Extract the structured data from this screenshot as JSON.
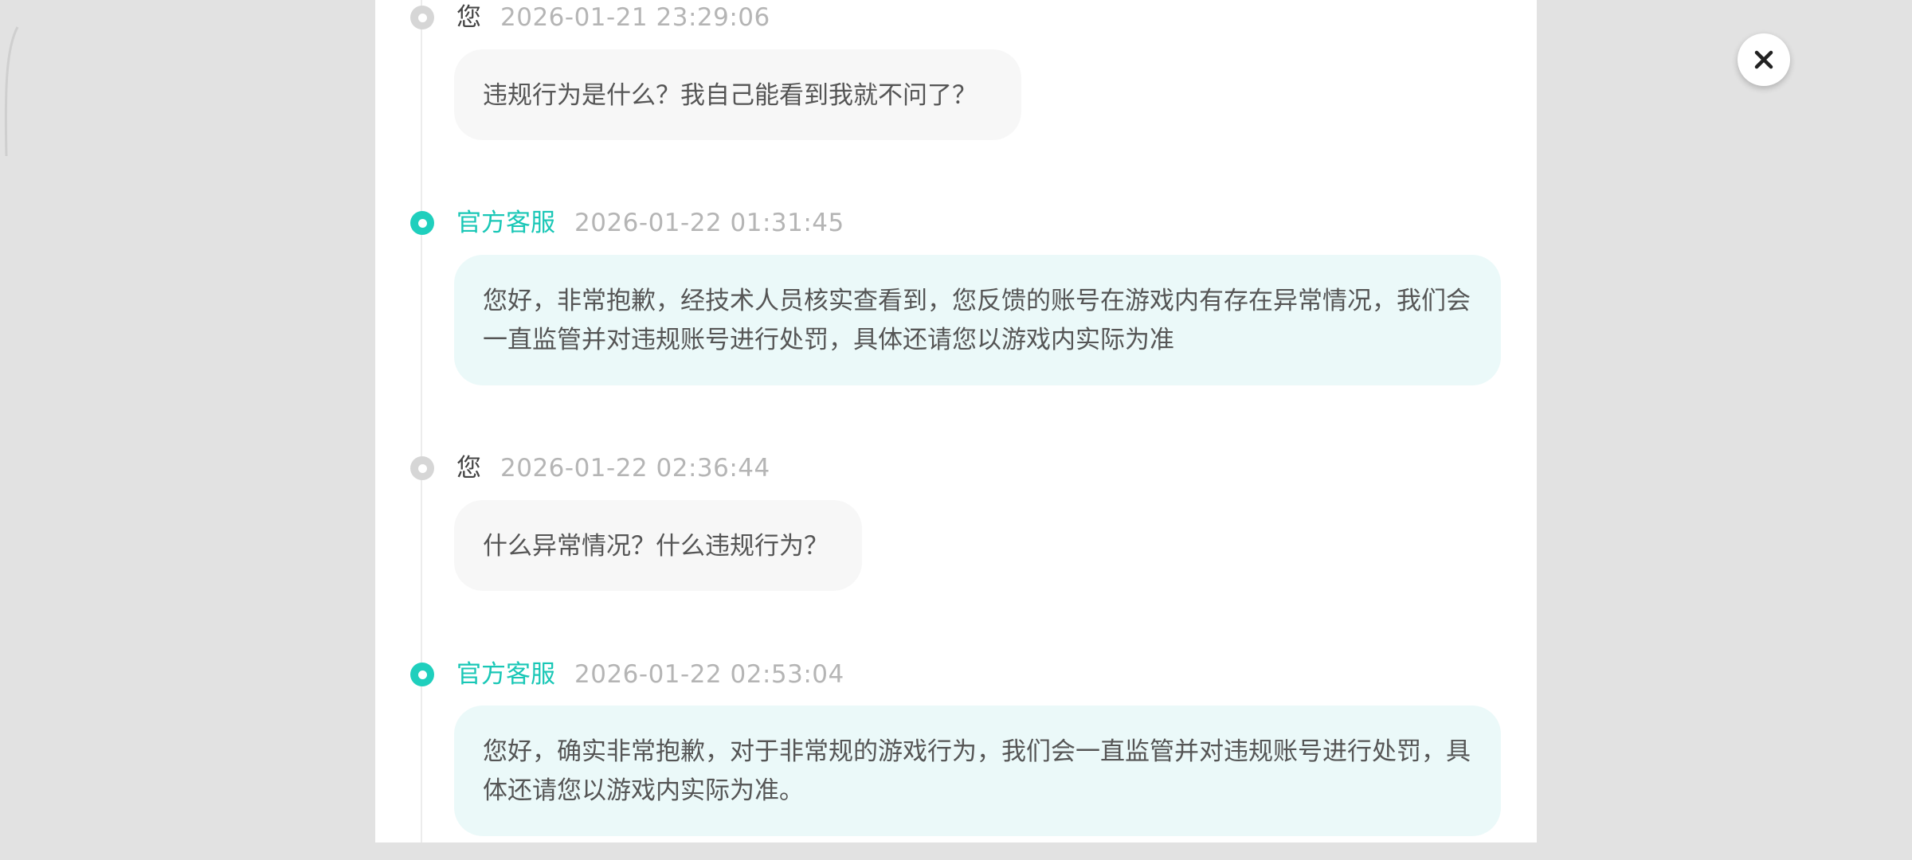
{
  "close_icon": "close-icon",
  "colors": {
    "accent": "#19c7b6",
    "agent_bubble": "#ebf9f9",
    "user_bubble": "#f7f7f7",
    "user_dot": "#d6d6d6"
  },
  "messages": [
    {
      "role": "user",
      "author": "您",
      "time": "2026-01-21 23:29:06",
      "text": "违规行为是什么？我自己能看到我就不问了？"
    },
    {
      "role": "agent",
      "author": "官方客服",
      "time": "2026-01-22 01:31:45",
      "text": "您好，非常抱歉，经技术人员核实查看到，您反馈的账号在游戏内有存在异常情况，我们会一直监管并对违规账号进行处罚，具体还请您以游戏内实际为准"
    },
    {
      "role": "user",
      "author": "您",
      "time": "2026-01-22 02:36:44",
      "text": "什么异常情况？什么违规行为？"
    },
    {
      "role": "agent",
      "author": "官方客服",
      "time": "2026-01-22 02:53:04",
      "text": "您好，确实非常抱歉，对于非常规的游戏行为，我们会一直监管并对违规账号进行处罚，具体还请您以游戏内实际为准。"
    }
  ]
}
